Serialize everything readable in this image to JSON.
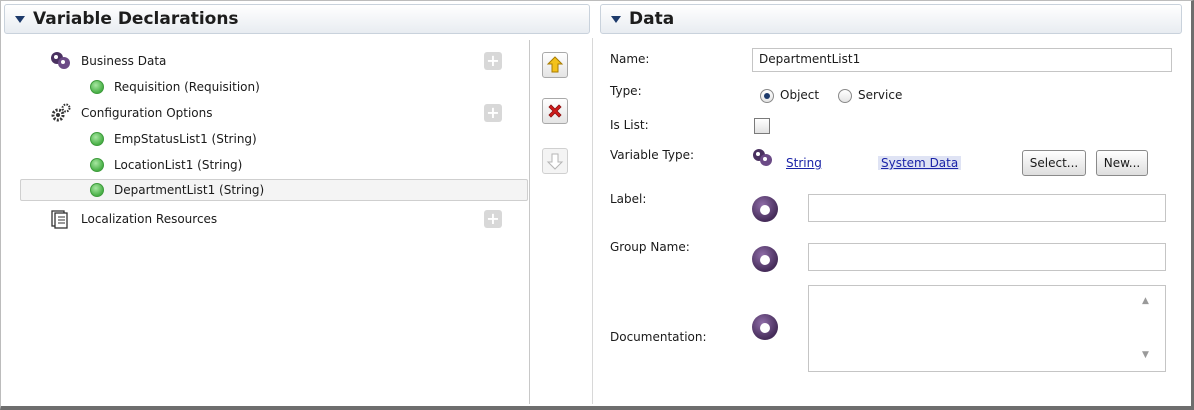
{
  "variable_declarations": {
    "title": "Variable Declarations",
    "tree": [
      {
        "label": "Business Data",
        "icon": "business-data-icon",
        "level": 0,
        "add": true
      },
      {
        "label": "Requisition (Requisition)",
        "icon": "green-dot-icon",
        "level": 1
      },
      {
        "label": "Configuration Options",
        "icon": "gears-icon",
        "level": 0,
        "add": true
      },
      {
        "label": "EmpStatusList1 (String)",
        "icon": "green-dot-icon",
        "level": 1
      },
      {
        "label": "LocationList1 (String)",
        "icon": "green-dot-icon",
        "level": 1
      },
      {
        "label": "DepartmentList1 (String)",
        "icon": "green-dot-icon",
        "level": 1,
        "selected": true
      },
      {
        "label": "Localization Resources",
        "icon": "document-stack-icon",
        "level": 0,
        "add": true
      }
    ]
  },
  "data_panel": {
    "title": "Data",
    "name_label": "Name:",
    "name_value": "DepartmentList1",
    "type_label": "Type:",
    "type_options": [
      "Object",
      "Service"
    ],
    "type_selected": "Object",
    "is_list_label": "Is List:",
    "is_list_checked": false,
    "variable_type_label": "Variable Type:",
    "variable_type_link": "String",
    "system_data_link": "System Data",
    "select_button": "Select...",
    "new_button": "New...",
    "label_label": "Label:",
    "label_value": "",
    "group_name_label": "Group Name:",
    "group_name_value": "",
    "documentation_label": "Documentation:",
    "documentation_value": ""
  },
  "colors": {
    "header_text": "#1d1d1d",
    "link": "#1b24a8",
    "accent_purple": "#452c59",
    "green_status": "#49b047",
    "delete_red": "#d01c1c",
    "up_arrow_yellow": "#f3c21a"
  }
}
